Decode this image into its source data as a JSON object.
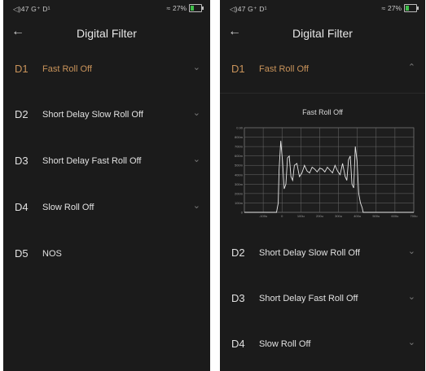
{
  "status": {
    "left": "◁)47 G⁺ D¹",
    "battery": "27%"
  },
  "screen_left": {
    "title": "Digital Filter",
    "items": [
      {
        "code": "D1",
        "label": "Fast Roll Off"
      },
      {
        "code": "D2",
        "label": "Short Delay Slow Roll Off"
      },
      {
        "code": "D3",
        "label": "Short Delay Fast Roll Off"
      },
      {
        "code": "D4",
        "label": "Slow Roll Off"
      },
      {
        "code": "D5",
        "label": "NOS"
      }
    ]
  },
  "screen_right": {
    "title": "Digital Filter",
    "expanded_title": "Fast Roll Off",
    "items": [
      {
        "code": "D1",
        "label": "Fast Roll Off"
      },
      {
        "code": "D2",
        "label": "Short Delay Slow Roll Off"
      },
      {
        "code": "D3",
        "label": "Short Delay Fast Roll Off"
      },
      {
        "code": "D4",
        "label": "Slow Roll Off"
      }
    ]
  },
  "icons": {
    "back": "arrow-left-icon",
    "collapsed": "chevron-down-icon",
    "expanded": "chevron-up-icon"
  },
  "colors": {
    "accent": "#c9935a",
    "background": "#1b1b1b"
  },
  "chart_data": {
    "type": "line",
    "title": "",
    "x_tick_labels": [
      "-100u",
      "0",
      "100u",
      "200u",
      "300u",
      "400u",
      "500u",
      "600u",
      "700u"
    ],
    "y_tick_labels": [
      "0.90",
      "800m",
      "700m",
      "600m",
      "500m",
      "400m",
      "300m",
      "200m",
      "100m",
      "0"
    ],
    "xlim": [
      -200,
      800
    ],
    "ylim": [
      0,
      0.9
    ],
    "grid": true,
    "series": [
      {
        "x": [
          -200,
          -10,
          -9,
          0,
          5,
          15,
          25,
          35,
          45,
          55,
          65,
          75,
          85,
          95,
          110,
          125,
          140,
          155,
          170,
          185,
          200,
          215,
          230,
          245,
          260,
          275,
          290,
          305,
          320,
          335,
          350,
          365,
          380,
          395,
          405,
          415,
          425,
          435,
          445,
          455,
          465,
          475,
          485,
          495,
          500,
          501,
          800
        ],
        "y": [
          0,
          0,
          0.01,
          0.1,
          0.45,
          0.76,
          0.55,
          0.25,
          0.3,
          0.58,
          0.6,
          0.38,
          0.34,
          0.5,
          0.52,
          0.38,
          0.42,
          0.5,
          0.44,
          0.42,
          0.48,
          0.46,
          0.43,
          0.47,
          0.46,
          0.43,
          0.48,
          0.45,
          0.42,
          0.5,
          0.44,
          0.4,
          0.52,
          0.38,
          0.34,
          0.56,
          0.6,
          0.3,
          0.26,
          0.7,
          0.55,
          0.2,
          0.1,
          0.05,
          0.01,
          0,
          0
        ]
      }
    ]
  }
}
